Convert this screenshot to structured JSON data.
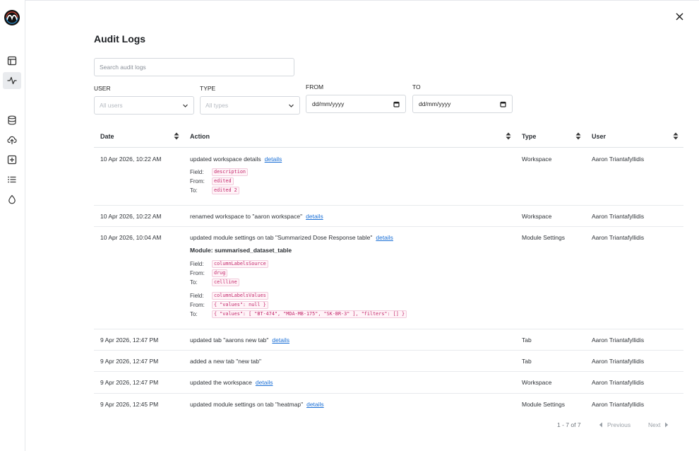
{
  "page": {
    "title": "Audit Logs"
  },
  "search": {
    "placeholder": "Search audit logs"
  },
  "filters": {
    "user": {
      "label": "USER",
      "placeholder": "All users"
    },
    "type": {
      "label": "TYPE",
      "placeholder": "All types"
    },
    "from": {
      "label": "FROM",
      "value": "dd/mm/yyyy"
    },
    "to": {
      "label": "TO",
      "value": "dd/mm/yyyy"
    }
  },
  "table": {
    "headers": {
      "date": "Date",
      "action": "Action",
      "type": "Type",
      "user": "User"
    },
    "rows": [
      {
        "date": "10 Apr 2026, 10:22 AM",
        "action": "updated workspace details",
        "link": "details",
        "type": "Workspace",
        "user": "Aaron Triantafyllidis",
        "changes": [
          {
            "field_label": "Field:",
            "field": "description",
            "from_label": "From:",
            "from": "edited",
            "to_label": "To:",
            "to": "edited 2"
          }
        ]
      },
      {
        "date": "10 Apr 2026, 10:22 AM",
        "action": "renamed workspace to \"aaron workspace\"",
        "link": "details",
        "type": "Workspace",
        "user": "Aaron Triantafyllidis"
      },
      {
        "date": "10 Apr 2026, 10:04 AM",
        "action": "updated module settings on tab \"Summarized Dose Response table\"",
        "link": "details",
        "type": "Module Settings",
        "user": "Aaron Triantafyllidis",
        "module": "Module: summarised_dataset_table",
        "changes": [
          {
            "field_label": "Field:",
            "field": "columnLabelsSource",
            "from_label": "From:",
            "from": "drug",
            "to_label": "To:",
            "to": "cellline"
          },
          {
            "field_label": "Field:",
            "field": "columnLabelsValues",
            "from_label": "From:",
            "from": "{ \"values\": null }",
            "to_label": "To:",
            "to": "{ \"values\": [ \"BT-474\", \"MDA-MB-175\", \"SK-BR-3\" ], \"filters\": [] }"
          }
        ]
      },
      {
        "date": "9 Apr 2026, 12:47 PM",
        "action": "updated tab \"aarons new tab\"",
        "link": "details",
        "type": "Tab",
        "user": "Aaron Triantafyllidis"
      },
      {
        "date": "9 Apr 2026, 12:47 PM",
        "action": "added a new tab \"new tab\"",
        "link": "",
        "type": "Tab",
        "user": "Aaron Triantafyllidis"
      },
      {
        "date": "9 Apr 2026, 12:47 PM",
        "action": "updated the workspace",
        "link": "details",
        "type": "Workspace",
        "user": "Aaron Triantafyllidis"
      },
      {
        "date": "9 Apr 2026, 12:45 PM",
        "action": "updated module settings on tab \"heatmap\"",
        "link": "details",
        "type": "Module Settings",
        "user": "Aaron Triantafyllidis"
      }
    ]
  },
  "pagination": {
    "range": "1 - 7 of 7",
    "previous": "Previous",
    "next": "Next"
  },
  "sidebar": {
    "icons": [
      "logo",
      "layout-icon",
      "activity-icon",
      "database-icon",
      "upload-cloud-icon",
      "plus-square-icon",
      "list-icon",
      "droplet-icon"
    ],
    "active": "activity-icon"
  },
  "colors": {
    "link": "#1a6fd6",
    "code_text": "#c4286c",
    "code_bg": "#fff4f8",
    "active_nav": "#e9ebee"
  }
}
